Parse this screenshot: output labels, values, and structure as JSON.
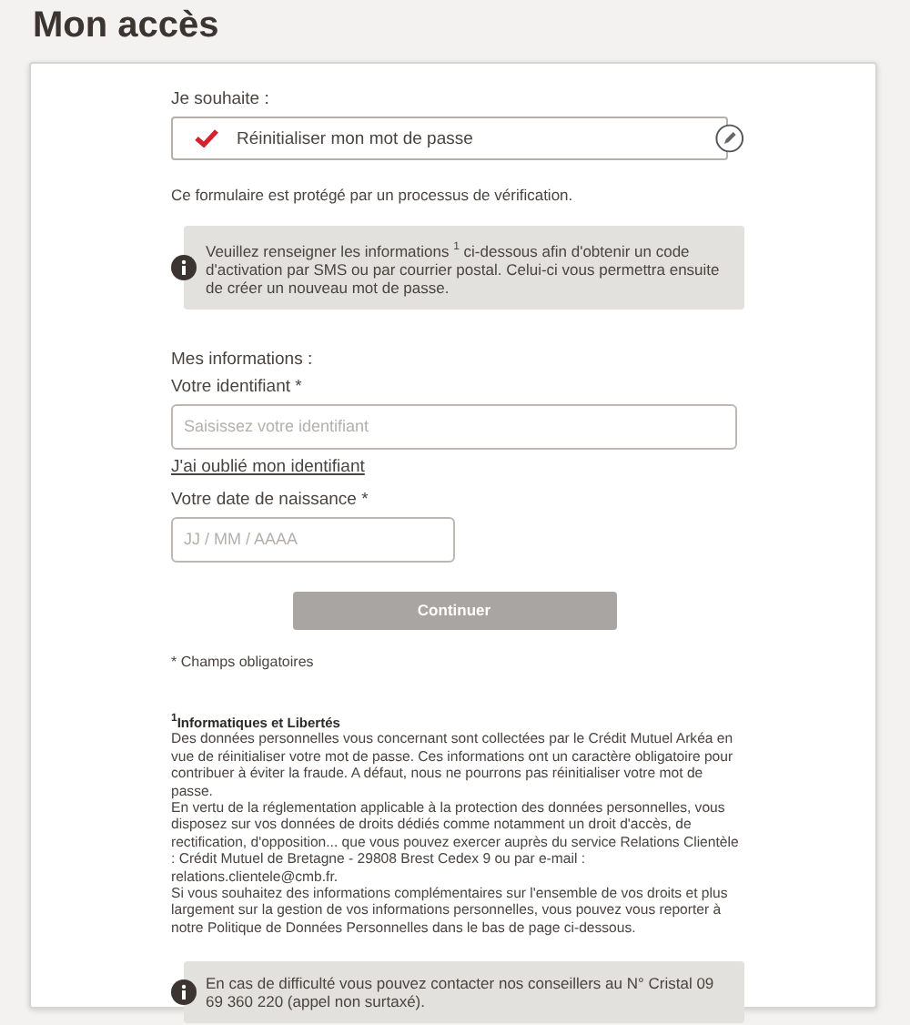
{
  "page_title": "Mon accès",
  "choice": {
    "label": "Je souhaite :",
    "value": "Réinitialiser mon mot de passe",
    "checked": true
  },
  "verification_note": "Ce formulaire est protégé par un processus de vérification.",
  "info_notice": "Veuillez renseigner les informations $^{1}$ ci-dessous afin d'obtenir un code d'activation par SMS ou par courrier postal. Celui-ci vous permettra ensuite de créer un nouveau mot de passe.",
  "section_label": "Mes informations :",
  "identifier": {
    "label": "Votre identifiant *",
    "placeholder": "Saisissez votre identifiant"
  },
  "forgot_link": "J'ai oublié mon identifiant",
  "birthdate": {
    "label": "Votre date de naissance *",
    "placeholder": "JJ / MM / AAAA"
  },
  "submit": {
    "label": "Continuer",
    "disabled": true
  },
  "required_note": "* Champs obligatoires",
  "legal": {
    "title": "$^{1}$Informatiques et Libertés",
    "paragraphs": [
      "Des données personnelles vous concernant sont collectées par le Crédit Mutuel Arkéa en vue de réinitialiser votre mot de passe. Ces informations ont un caractère obligatoire pour contribuer à éviter la fraude. A défaut, nous ne pourrons pas réinitialiser votre mot de passe.",
      "En vertu de la réglementation applicable à la protection des données personnelles, vous disposez sur vos données de droits dédiés comme notamment un droit d'accès, de rectification, d'opposition... que vous pouvez exercer auprès du service Relations Clientèle : Crédit Mutuel de Bretagne - 29808 Brest Cedex 9 ou par e-mail : relations.clientele@cmb.fr.",
      "Si vous souhaitez des informations complémentaires sur l'ensemble de vos droits et plus largement sur la gestion de vos informations personnelles, vous pouvez vous reporter à notre Politique de Données Personnelles dans le bas de page ci-dessous."
    ]
  },
  "contact_notice": "En cas de difficulté vous pouvez contacter nos conseillers au N° Cristal 09 69 360 220 (appel non surtaxé)."
}
